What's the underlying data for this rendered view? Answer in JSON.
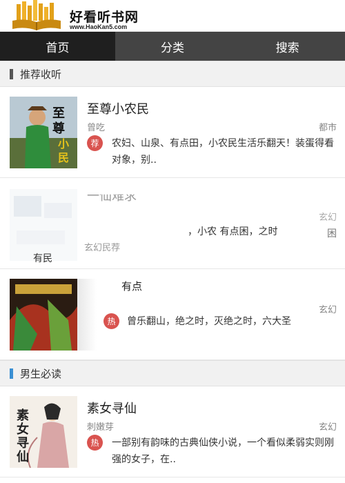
{
  "header": {
    "title": "好看听书网",
    "url": "www.HaoKan5.com"
  },
  "nav": {
    "tabs": [
      {
        "label": "首页",
        "active": true
      },
      {
        "label": "分类",
        "active": false
      },
      {
        "label": "搜索",
        "active": false
      }
    ]
  },
  "sections": [
    {
      "title": "推荐收听",
      "bar_color": "#555555",
      "books": [
        {
          "title": "至尊小农民",
          "author": "曾吃",
          "category": "都市",
          "badge": "荐",
          "desc": "农妇、山泉、有点田，小农民生活乐翻天！装蛋得看对象，别.."
        },
        {
          "title": "一仙难求",
          "author": "",
          "category": "玄幻",
          "badge": "",
          "desc": "，小农  有点困，之时"
        },
        {
          "title": "有点",
          "author": "",
          "category": "玄幻",
          "badge": "热",
          "desc": "曾乐翻山，绝之时，灭绝之时，六大圣"
        }
      ]
    },
    {
      "title": "男生必读",
      "bar_color": "#3a8fd3",
      "books": [
        {
          "title": "素女寻仙",
          "author": "刺嫩芽",
          "category": "玄幻",
          "badge": "热",
          "desc": "一部别有韵味的古典仙侠小说，一个看似柔弱实则刚强的女子，在.."
        }
      ]
    }
  ],
  "row2_extras": {
    "tag_line": "玄幻民荐",
    "bottom_text": "有民",
    "right_text": "困"
  },
  "colors": {
    "nav_bg": "#444444",
    "nav_active": "#1f1f1f",
    "badge_bg": "#d9534f"
  }
}
